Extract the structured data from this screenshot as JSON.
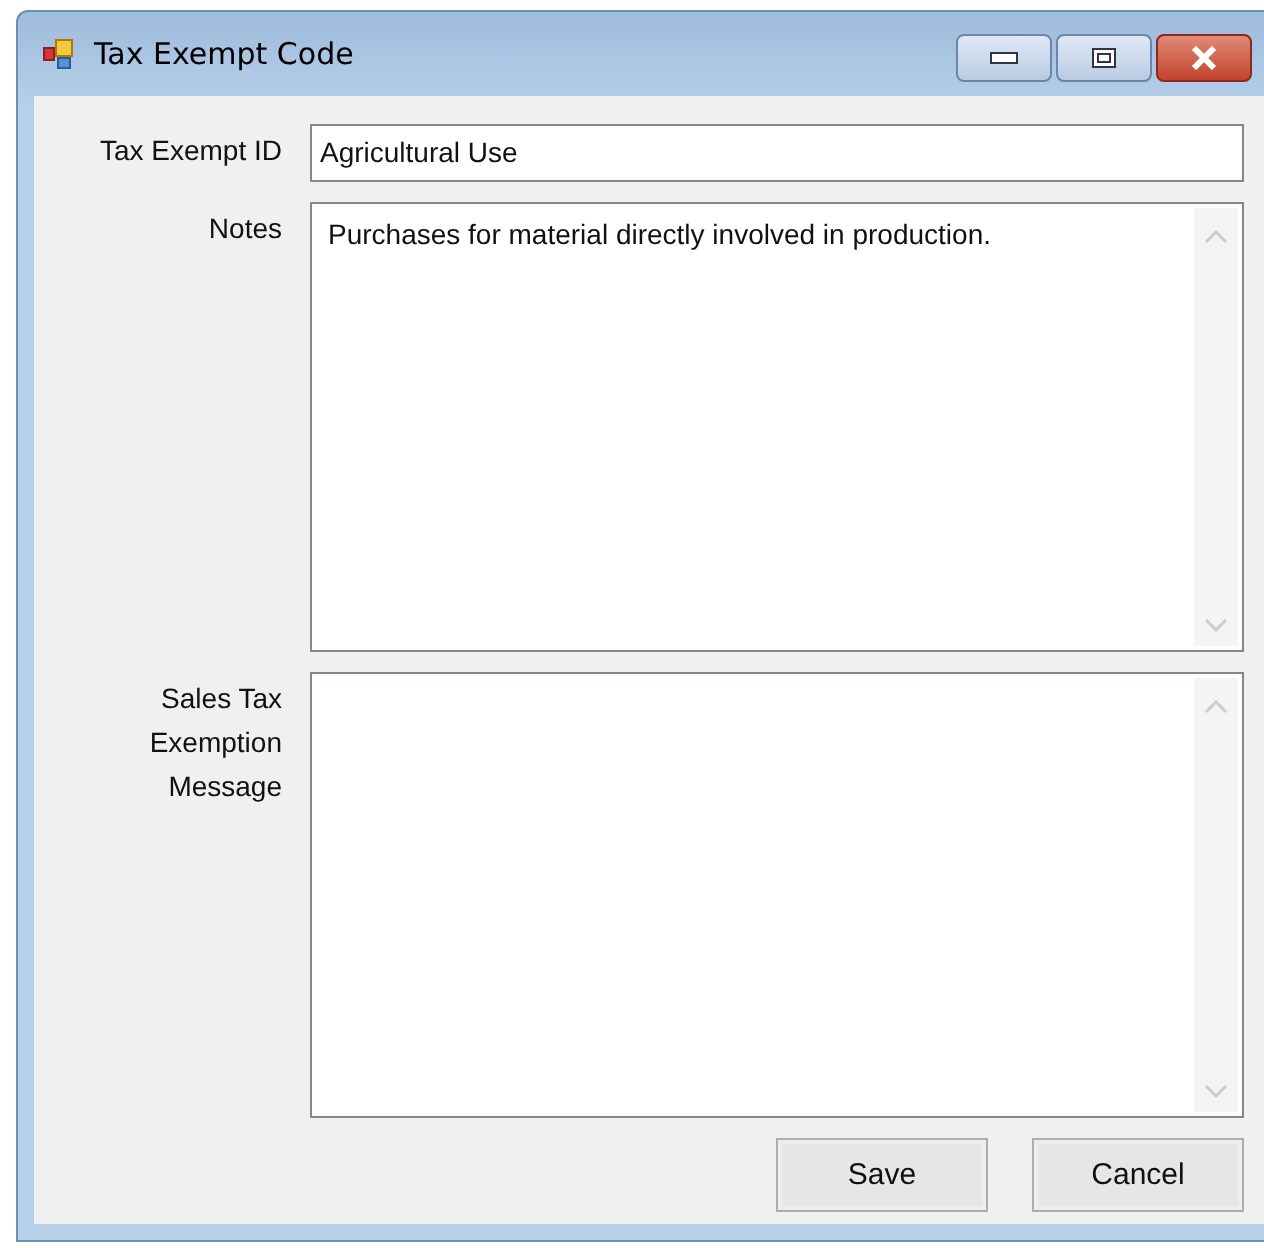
{
  "window": {
    "title": "Tax Exempt Code"
  },
  "fields": [
    {
      "label": "Tax Exempt ID",
      "kind": "line",
      "value": "Agricultural Use"
    },
    {
      "label": "Notes",
      "kind": "multiline",
      "value": "Purchases for material directly involved in production."
    },
    {
      "label": "Sales Tax Exemption Message",
      "kind": "multiline"
    }
  ],
  "buttons": [
    "Save",
    "Cancel"
  ]
}
